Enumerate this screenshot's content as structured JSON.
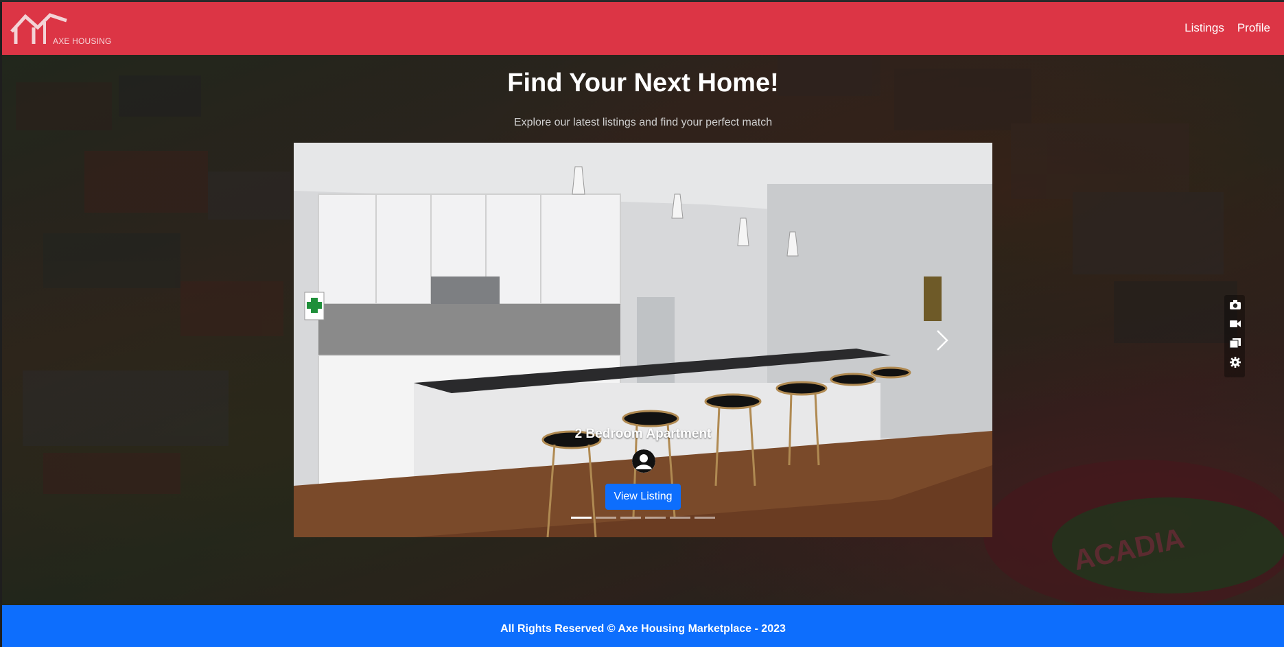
{
  "navbar": {
    "brand_text": "AXE HOUSING",
    "links": [
      {
        "label": "Listings"
      },
      {
        "label": "Profile"
      }
    ],
    "color": "#dc3545"
  },
  "hero": {
    "title": "Find Your Next Home!",
    "subtitle": "Explore our latest listings and find your perfect match"
  },
  "carousel": {
    "slide_title": "2 Bedroom Apartment",
    "button_label": "View Listing",
    "indicator_count": 6,
    "active_index": 0
  },
  "side_tools": {
    "icons": [
      "camera-icon",
      "video-icon",
      "copy-icon",
      "gear-icon"
    ]
  },
  "footer": {
    "text": "All Rights Reserved © Axe Housing Marketplace - 2023",
    "color": "#0d6efd"
  }
}
